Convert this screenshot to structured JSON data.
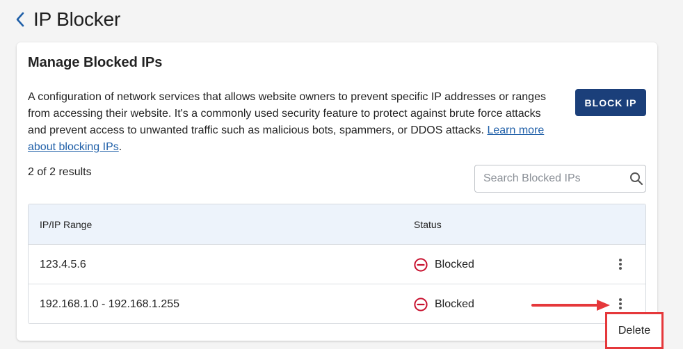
{
  "page": {
    "title": "IP Blocker"
  },
  "card": {
    "title": "Manage Blocked IPs",
    "description": "A configuration of network services that allows website owners to prevent specific IP addresses or ranges from accessing their website. It's a commonly used security feature to protect against brute force attacks and prevent access to unwanted traffic such as malicious bots, spammers, or DDOS attacks.",
    "learn_more_link": "Learn more about blocking IPs",
    "link_suffix": ".",
    "block_button": "BLOCK IP",
    "result_count": "2 of 2 results",
    "search_placeholder": "Search Blocked IPs"
  },
  "table": {
    "headers": [
      "IP/IP Range",
      "Status"
    ],
    "rows": [
      {
        "ip": "123.4.5.6",
        "status": "Blocked"
      },
      {
        "ip": "192.168.1.0 - 192.168.1.255",
        "status": "Blocked"
      }
    ]
  },
  "context_menu": {
    "delete_label": "Delete"
  },
  "colors": {
    "primary_button": "#1b3f7a",
    "link": "#1f5fa8",
    "blocked_icon": "#c8102e",
    "annotation_red": "#e5383b",
    "table_header_bg": "#edf3fb"
  },
  "icons": {
    "back": "chevron-left-icon",
    "search": "search-icon",
    "status": "blocked-circle-icon",
    "row_actions": "kebab-menu-icon"
  }
}
